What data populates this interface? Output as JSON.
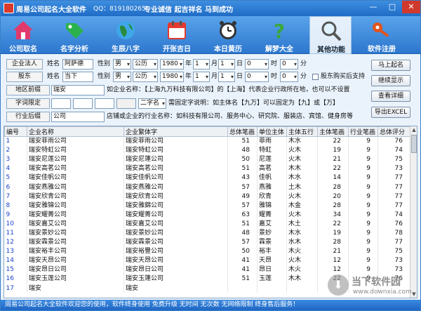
{
  "window": {
    "title": "周易公司起名大全软件",
    "qq": "QQ：819180265",
    "slogan": "专业诚信 起吉祥名 马到成功",
    "min": "—",
    "max": "□",
    "close": "✕"
  },
  "toolbar": [
    {
      "label": "公司取名",
      "icon": "house-icon",
      "color": "#e03a6c"
    },
    {
      "label": "名字分析",
      "icon": "tag-icon",
      "color": "#2bb24c"
    },
    {
      "label": "生辰八字",
      "icon": "globe-icon",
      "color": "#2a8a3c"
    },
    {
      "label": "开张吉日",
      "icon": "calendar-icon",
      "color": "#e23b2d"
    },
    {
      "label": "本日黄历",
      "icon": "clock-icon",
      "color": "#333333"
    },
    {
      "label": "解梦大全",
      "icon": "question-icon",
      "color": "#39a83b"
    },
    {
      "label": "其他功能",
      "icon": "magnifier-icon",
      "color": "#555555"
    },
    {
      "label": "软件注册",
      "icon": "key-icon",
      "color": "#e0541f"
    }
  ],
  "form": {
    "legal": {
      "label": "企业法人",
      "name_label": "姓名",
      "name": "阿萨德",
      "gender_label": "性别",
      "gender": "男",
      "calendar": "公历",
      "year": "1980",
      "year_unit": "年",
      "month": "1",
      "month_unit": "月",
      "day": "1",
      "day_unit": "日",
      "hour": "0",
      "hour_unit": "时",
      "minute": "0",
      "minute_unit": "分"
    },
    "shareholder": {
      "label": "股东",
      "name_label": "姓名",
      "name": "当下",
      "gender_label": "性别",
      "gender": "男",
      "calendar": "公历",
      "year": "1980",
      "year_unit": "年",
      "month": "1",
      "month_unit": "月",
      "day": "1",
      "day_unit": "日",
      "hour": "0",
      "hour_unit": "时",
      "minute": "0",
      "minute_unit": "分",
      "checkbox_label": "股东购买后支持"
    },
    "prefix": {
      "label": "地区前缀",
      "value": "瑞安",
      "hint": "如企业名称：【上海九万科技有限公司】的【上海】代表企业行政所在地，也可以不设置"
    },
    "fixed": {
      "label": "字词限定",
      "select": "二字名",
      "hint": "需固定字说明：如主体名【九万】可以固定为【九】或【万】"
    },
    "suffix": {
      "label": "行业后缀",
      "value": "公司",
      "hint": "店铺或企业的行业名称：如科技有限公司、服务中心、研究院、服装店、宾馆、健身房等"
    },
    "buttons": {
      "start": "马上起名",
      "next": "继续显示",
      "detail": "查看详细",
      "export": "导出EXCEL"
    }
  },
  "table": {
    "headers": [
      "编号",
      "企业名称",
      "企业繁体字",
      "总体笔画",
      "单位主体",
      "主体五行",
      "主体笔画",
      "行业笔画",
      "总体评分"
    ],
    "rows": [
      [
        "1",
        "瑞安菲雨公司",
        "瑞安菲雨公司",
        "51",
        "菲雨",
        "木水",
        "22",
        "9",
        "76"
      ],
      [
        "2",
        "瑞安特虹公司",
        "瑞安特虹公司",
        "48",
        "特虹",
        "火木",
        "19",
        "9",
        "74"
      ],
      [
        "3",
        "瑞安尼莲公司",
        "瑞安尼蓮公司",
        "50",
        "尼莲",
        "火木",
        "21",
        "9",
        "75"
      ],
      [
        "4",
        "瑞安高茗公司",
        "瑞安高茗公司",
        "51",
        "高茗",
        "木木",
        "22",
        "9",
        "73"
      ],
      [
        "5",
        "瑞安佳帆公司",
        "瑞安佳帆公司",
        "43",
        "佳帆",
        "木水",
        "14",
        "9",
        "77"
      ],
      [
        "6",
        "瑞安燕雅公司",
        "瑞安燕雅公司",
        "57",
        "燕雅",
        "土木",
        "28",
        "9",
        "77"
      ],
      [
        "7",
        "瑞安欣青公司",
        "瑞安欣青公司",
        "49",
        "欣青",
        "火木",
        "20",
        "9",
        "77"
      ],
      [
        "8",
        "瑞安雅锦公司",
        "瑞安雅錦公司",
        "57",
        "雅锦",
        "木金",
        "28",
        "9",
        "77"
      ],
      [
        "9",
        "瑞安耀菁公司",
        "瑞安耀菁公司",
        "63",
        "耀菁",
        "火木",
        "34",
        "9",
        "74"
      ],
      [
        "10",
        "瑞安嘉艾公司",
        "瑞安嘉艾公司",
        "51",
        "嘉艾",
        "木土",
        "22",
        "9",
        "76"
      ],
      [
        "11",
        "瑞安景妙公司",
        "瑞安景妙公司",
        "48",
        "景妙",
        "木水",
        "19",
        "9",
        "78"
      ],
      [
        "12",
        "瑞安霖景公司",
        "瑞安霖景公司",
        "57",
        "霖景",
        "水木",
        "28",
        "9",
        "77"
      ],
      [
        "13",
        "瑞安裕丰公司",
        "瑞安裕豐公司",
        "50",
        "裕丰",
        "木火",
        "21",
        "9",
        "75"
      ],
      [
        "14",
        "瑞安天昂公司",
        "瑞安天昂公司",
        "41",
        "天昂",
        "火木",
        "12",
        "9",
        "73"
      ],
      [
        "15",
        "瑞安昂日公司",
        "瑞安昂日公司",
        "41",
        "昂日",
        "木火",
        "12",
        "9",
        "73"
      ],
      [
        "16",
        "瑞安玉莲公司",
        "瑞安玉蓮公司",
        "51",
        "玉莲",
        "木木",
        "22",
        "9",
        "76"
      ],
      [
        "17",
        "瑞安",
        "瑞安",
        "",
        "",
        "",
        "",
        "",
        ""
      ]
    ]
  },
  "watermark": {
    "main": "当下软件园",
    "sub": "www.downxia.com"
  },
  "status": "周易公司起名大全软件欢迎您的使用，软件终身使用  免费升级  无时间  无次数  无网络限制  终身售后服务！"
}
